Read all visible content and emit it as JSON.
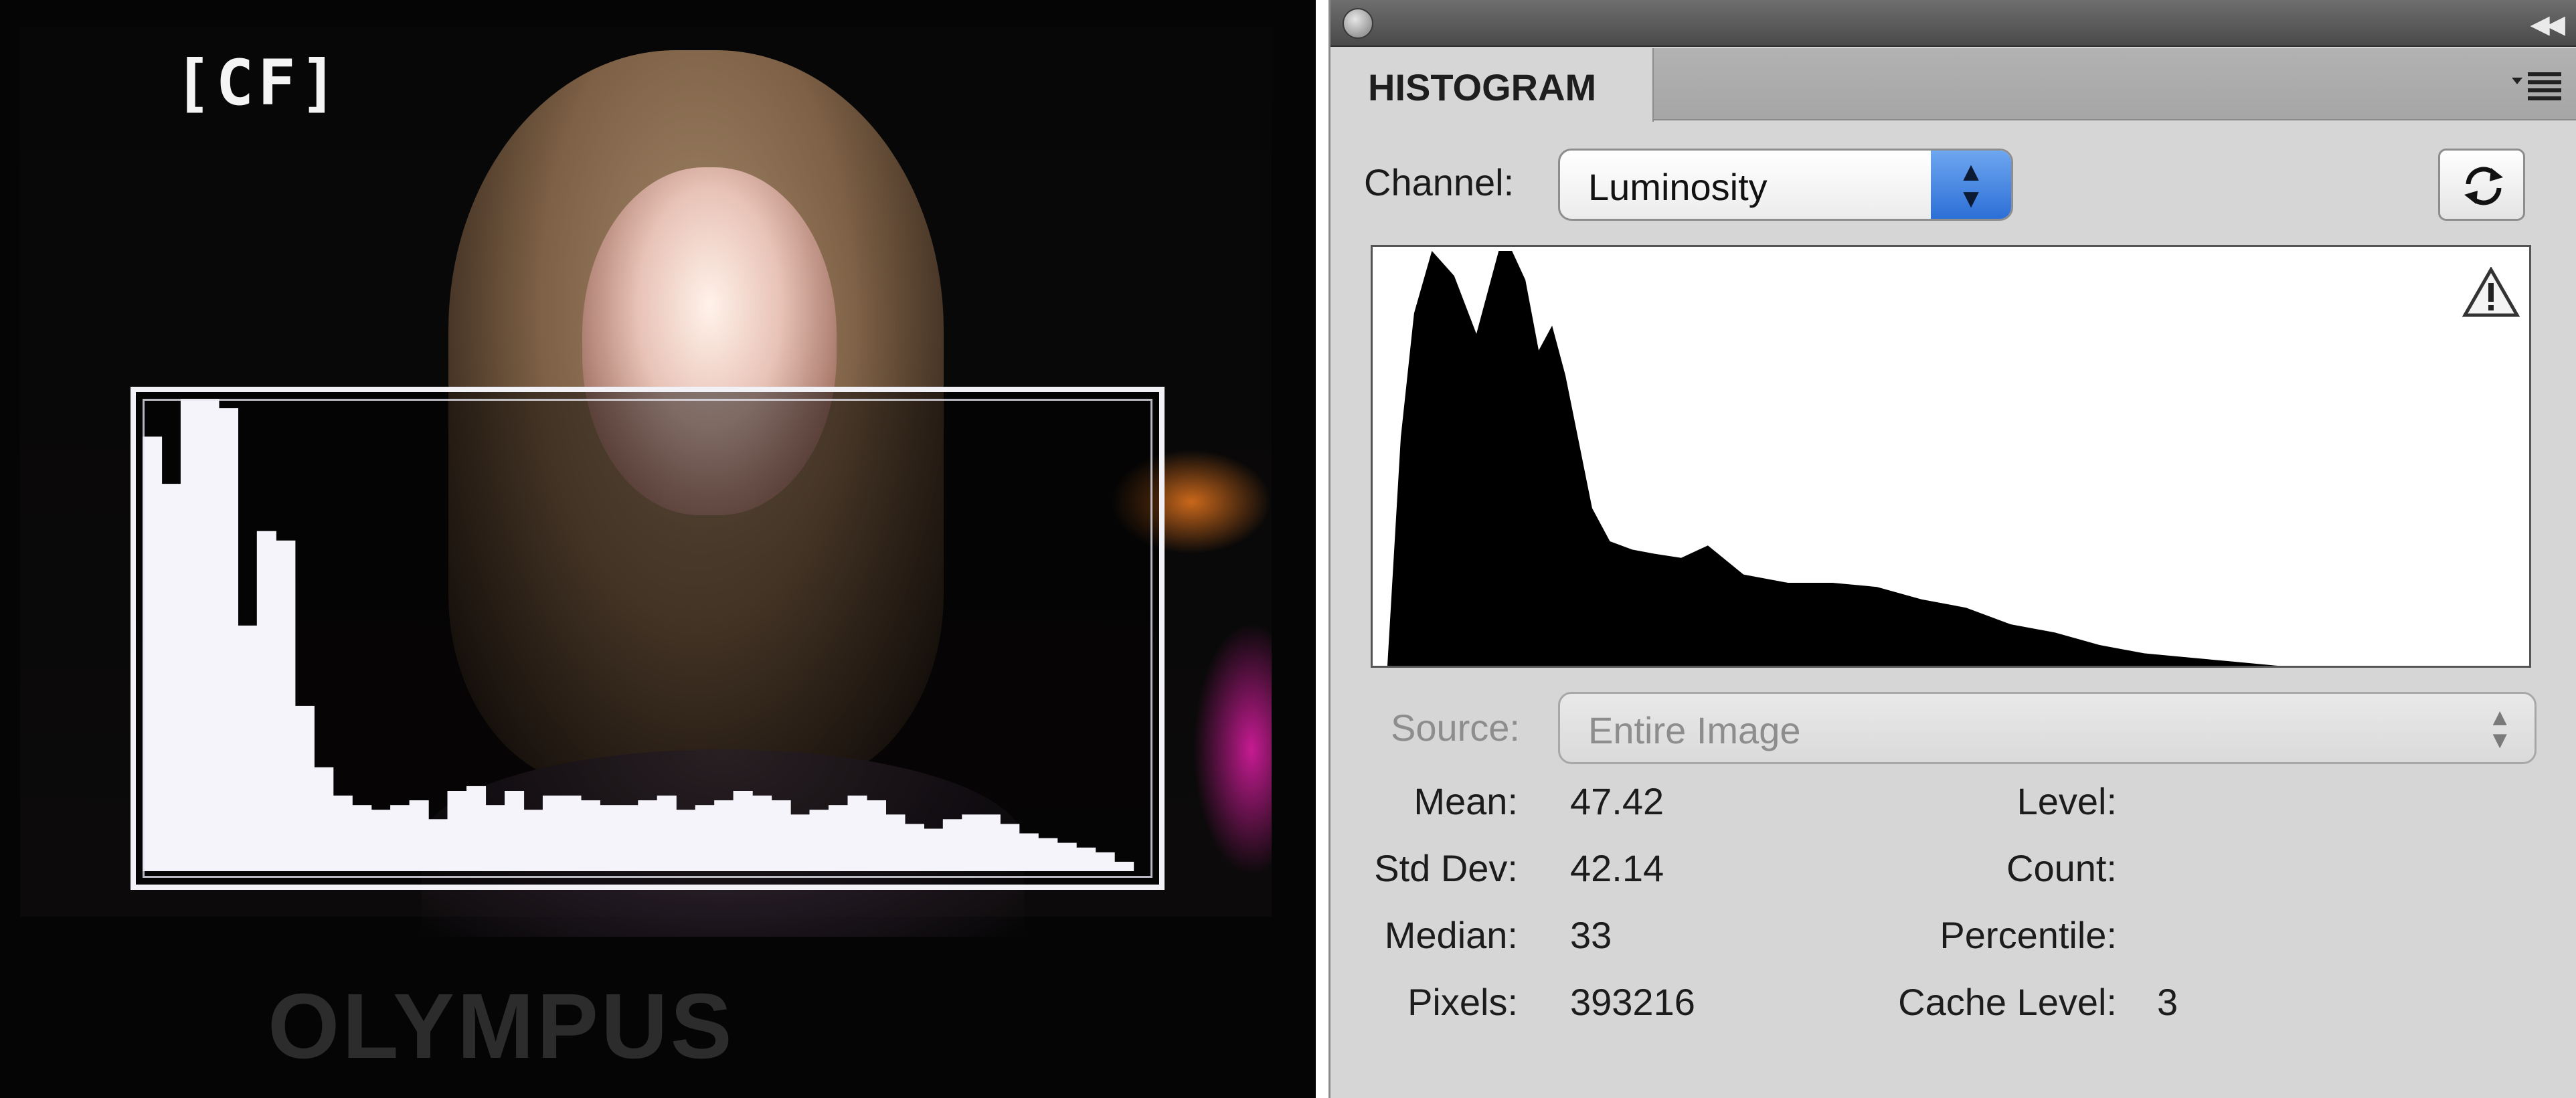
{
  "camera": {
    "card_label": "[CF]",
    "brand": "OLYMPUS"
  },
  "panel": {
    "tab_label": "HISTOGRAM",
    "channel": {
      "label": "Channel:",
      "value": "Luminosity"
    },
    "source": {
      "label": "Source:",
      "value": "Entire Image"
    },
    "stats": {
      "mean": {
        "label": "Mean:",
        "value": "47.42"
      },
      "stddev": {
        "label": "Std Dev:",
        "value": "42.14"
      },
      "median": {
        "label": "Median:",
        "value": "33"
      },
      "pixels": {
        "label": "Pixels:",
        "value": "393216"
      },
      "level": {
        "label": "Level:",
        "value": ""
      },
      "count": {
        "label": "Count:",
        "value": ""
      },
      "percentile": {
        "label": "Percentile:",
        "value": ""
      },
      "cache_level": {
        "label": "Cache Level:",
        "value": "3"
      }
    },
    "colors": {
      "panel_bg": "#d6d6d6",
      "select_accent": "#2c6fd6",
      "histogram_fill": "#000000"
    }
  },
  "chart_data": [
    {
      "type": "area",
      "title": "",
      "xlabel": "",
      "ylabel": "",
      "grid": false,
      "xlim": [
        0,
        255
      ],
      "ylim": [
        0,
        1
      ],
      "x": [
        0,
        3,
        6,
        10,
        15,
        20,
        25,
        28,
        31,
        34,
        37,
        40,
        43,
        46,
        50,
        55,
        60,
        66,
        72,
        80,
        90,
        100,
        110,
        120,
        130,
        140,
        150,
        160,
        170,
        180,
        190,
        200,
        205,
        210,
        215,
        220,
        230,
        240,
        255
      ],
      "values": [
        0.0,
        0.55,
        0.85,
        1.0,
        0.94,
        0.8,
        1.0,
        1.0,
        0.93,
        0.76,
        0.82,
        0.7,
        0.54,
        0.38,
        0.3,
        0.28,
        0.27,
        0.26,
        0.29,
        0.22,
        0.2,
        0.2,
        0.19,
        0.16,
        0.14,
        0.1,
        0.08,
        0.05,
        0.03,
        0.02,
        0.01,
        0.0,
        0.0,
        0.0,
        0.0,
        0.0,
        0.0,
        0.0,
        0.0
      ]
    },
    {
      "type": "bar",
      "title": "",
      "xlabel": "",
      "ylabel": "",
      "grid": false,
      "xlim": [
        0,
        53
      ],
      "ylim": [
        0,
        1
      ],
      "values": [
        0.92,
        0.82,
        1.0,
        1.0,
        0.98,
        0.52,
        0.72,
        0.7,
        0.35,
        0.22,
        0.16,
        0.14,
        0.13,
        0.14,
        0.15,
        0.11,
        0.17,
        0.18,
        0.14,
        0.17,
        0.13,
        0.16,
        0.16,
        0.15,
        0.14,
        0.14,
        0.15,
        0.16,
        0.13,
        0.14,
        0.15,
        0.17,
        0.16,
        0.15,
        0.12,
        0.13,
        0.14,
        0.16,
        0.15,
        0.12,
        0.1,
        0.09,
        0.11,
        0.12,
        0.12,
        0.1,
        0.08,
        0.07,
        0.06,
        0.05,
        0.04,
        0.02,
        0.0
      ]
    }
  ]
}
